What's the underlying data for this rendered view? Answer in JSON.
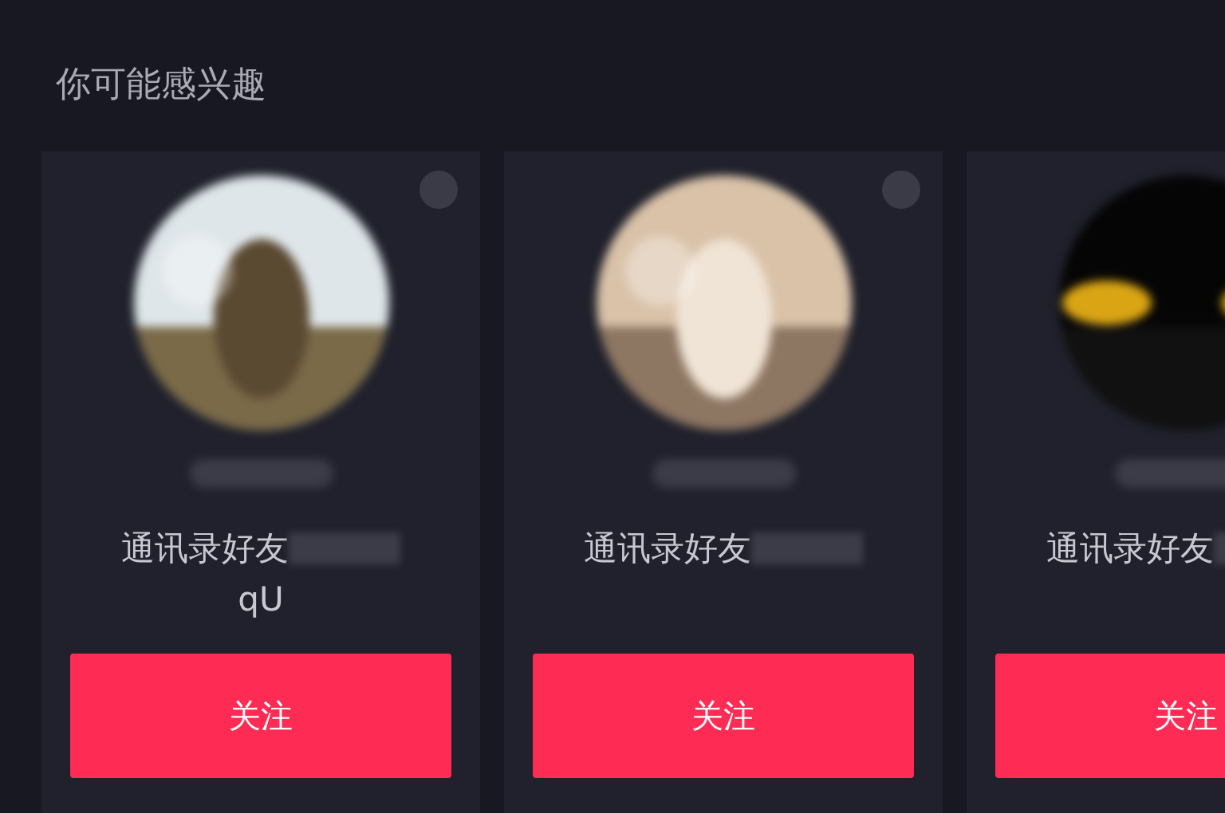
{
  "section_title": "你可能感兴趣",
  "cards": [
    {
      "close_icon": true,
      "avatar": {
        "kind": "picture"
      },
      "description": [
        "通讯录好友",
        "qU"
      ],
      "follow_button": "关注"
    },
    {
      "close_icon": true,
      "avatar": {
        "kind": "picture"
      },
      "description": [
        "通讯录好友"
      ],
      "follow_button": "关注"
    },
    {
      "avatar": {
        "kind": "picture"
      },
      "description": [
        "通讯录好友"
      ],
      "follow_button": "关注"
    }
  ]
}
